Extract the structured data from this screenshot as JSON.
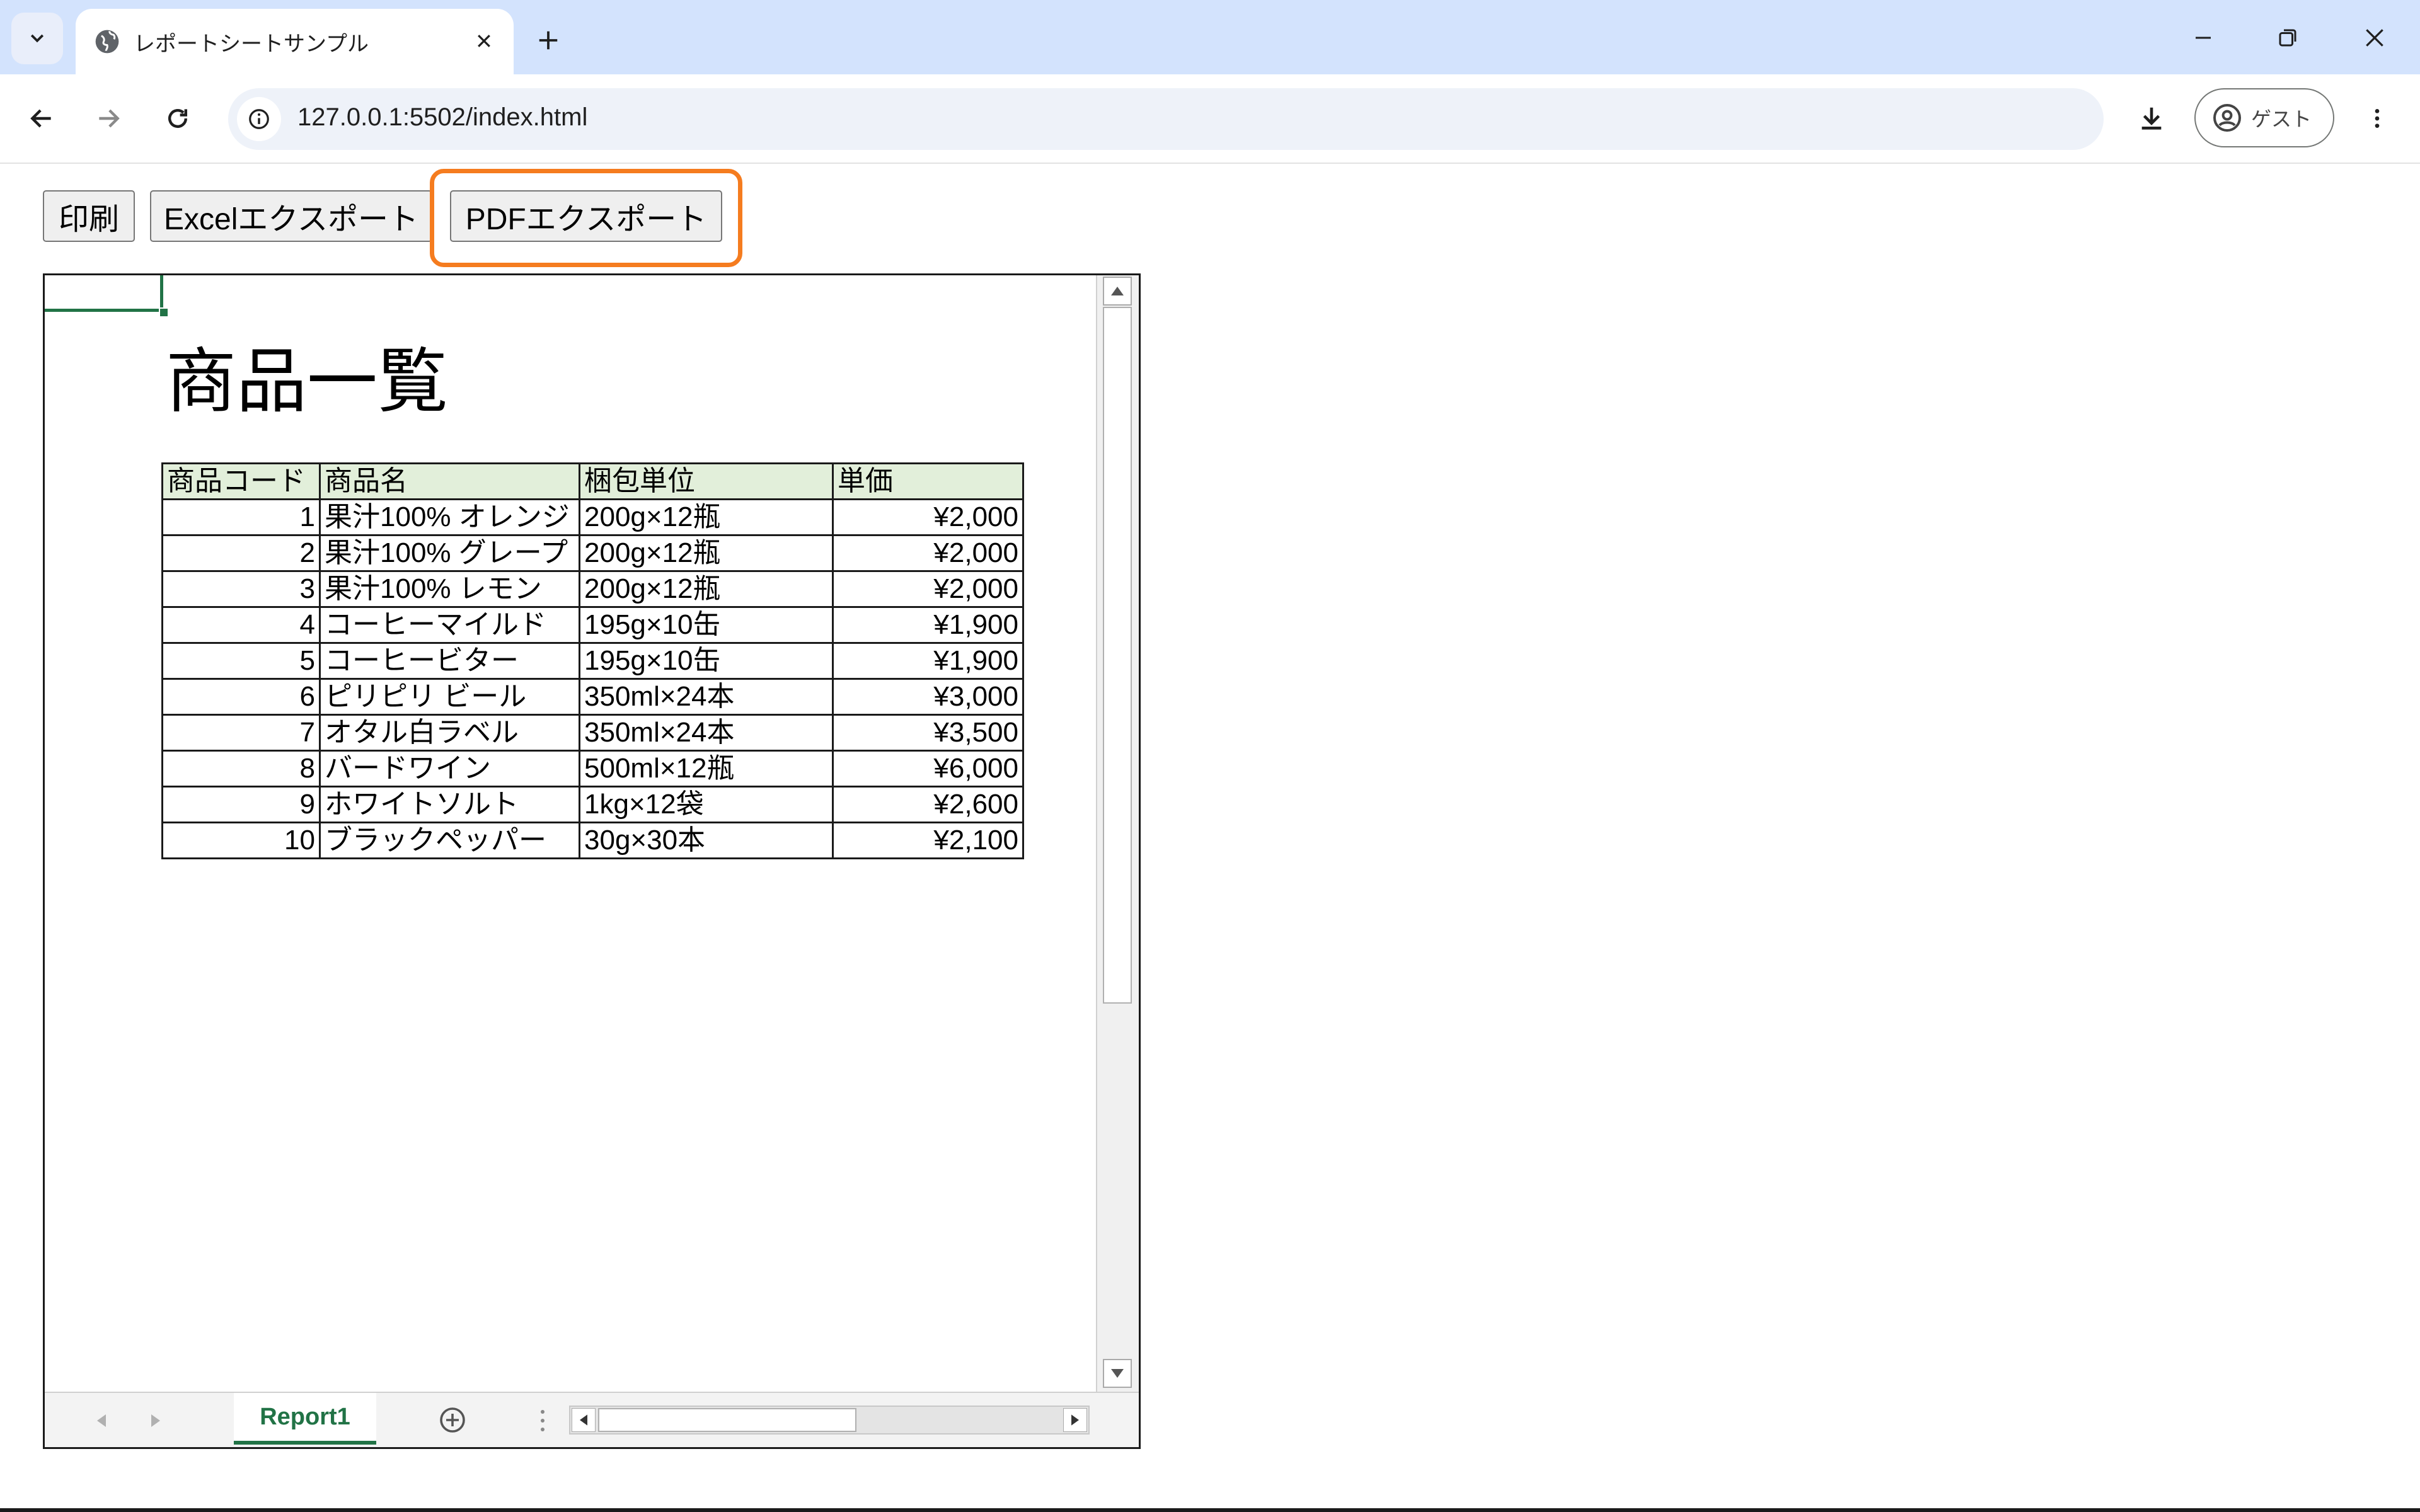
{
  "browser": {
    "tab_title": "レポートシートサンプル",
    "url": "127.0.0.1:5502/index.html",
    "profile_label": "ゲスト"
  },
  "buttons": {
    "print": "印刷",
    "excel_export": "Excelエクスポート",
    "pdf_export": "PDFエクスポート"
  },
  "sheet": {
    "title": "商品一覧",
    "headers": [
      "商品コード",
      "商品名",
      "梱包単位",
      "単価"
    ],
    "header_fill": "#e2efda",
    "rows": [
      [
        "1",
        "果汁100% オレンジ",
        "200g×12瓶",
        "¥2,000"
      ],
      [
        "2",
        "果汁100% グレープ",
        "200g×12瓶",
        "¥2,000"
      ],
      [
        "3",
        "果汁100% レモン",
        "200g×12瓶",
        "¥2,000"
      ],
      [
        "4",
        "コーヒーマイルド",
        "195g×10缶",
        "¥1,900"
      ],
      [
        "5",
        "コーヒービター",
        "195g×10缶",
        "¥1,900"
      ],
      [
        "6",
        "ピリピリ ビール",
        "350ml×24本",
        "¥3,000"
      ],
      [
        "7",
        "オタル白ラベル",
        "350ml×24本",
        "¥3,500"
      ],
      [
        "8",
        "バードワイン",
        "500ml×12瓶",
        "¥6,000"
      ],
      [
        "9",
        "ホワイトソルト",
        "1kg×12袋",
        "¥2,600"
      ],
      [
        "10",
        "ブラックペッパー",
        "30g×30本",
        "¥2,100"
      ]
    ],
    "sheet_tab_label": "Report1",
    "accent_color": "#217346"
  },
  "focus_color": "#f57c1f",
  "icons": [
    "tab-list-icon",
    "globe-icon",
    "close-icon",
    "plus-icon",
    "minimize-icon",
    "restore-icon",
    "window-close-icon",
    "back-icon",
    "forward-icon",
    "reload-icon",
    "site-info-icon",
    "download-icon",
    "account-icon",
    "more-icon"
  ]
}
